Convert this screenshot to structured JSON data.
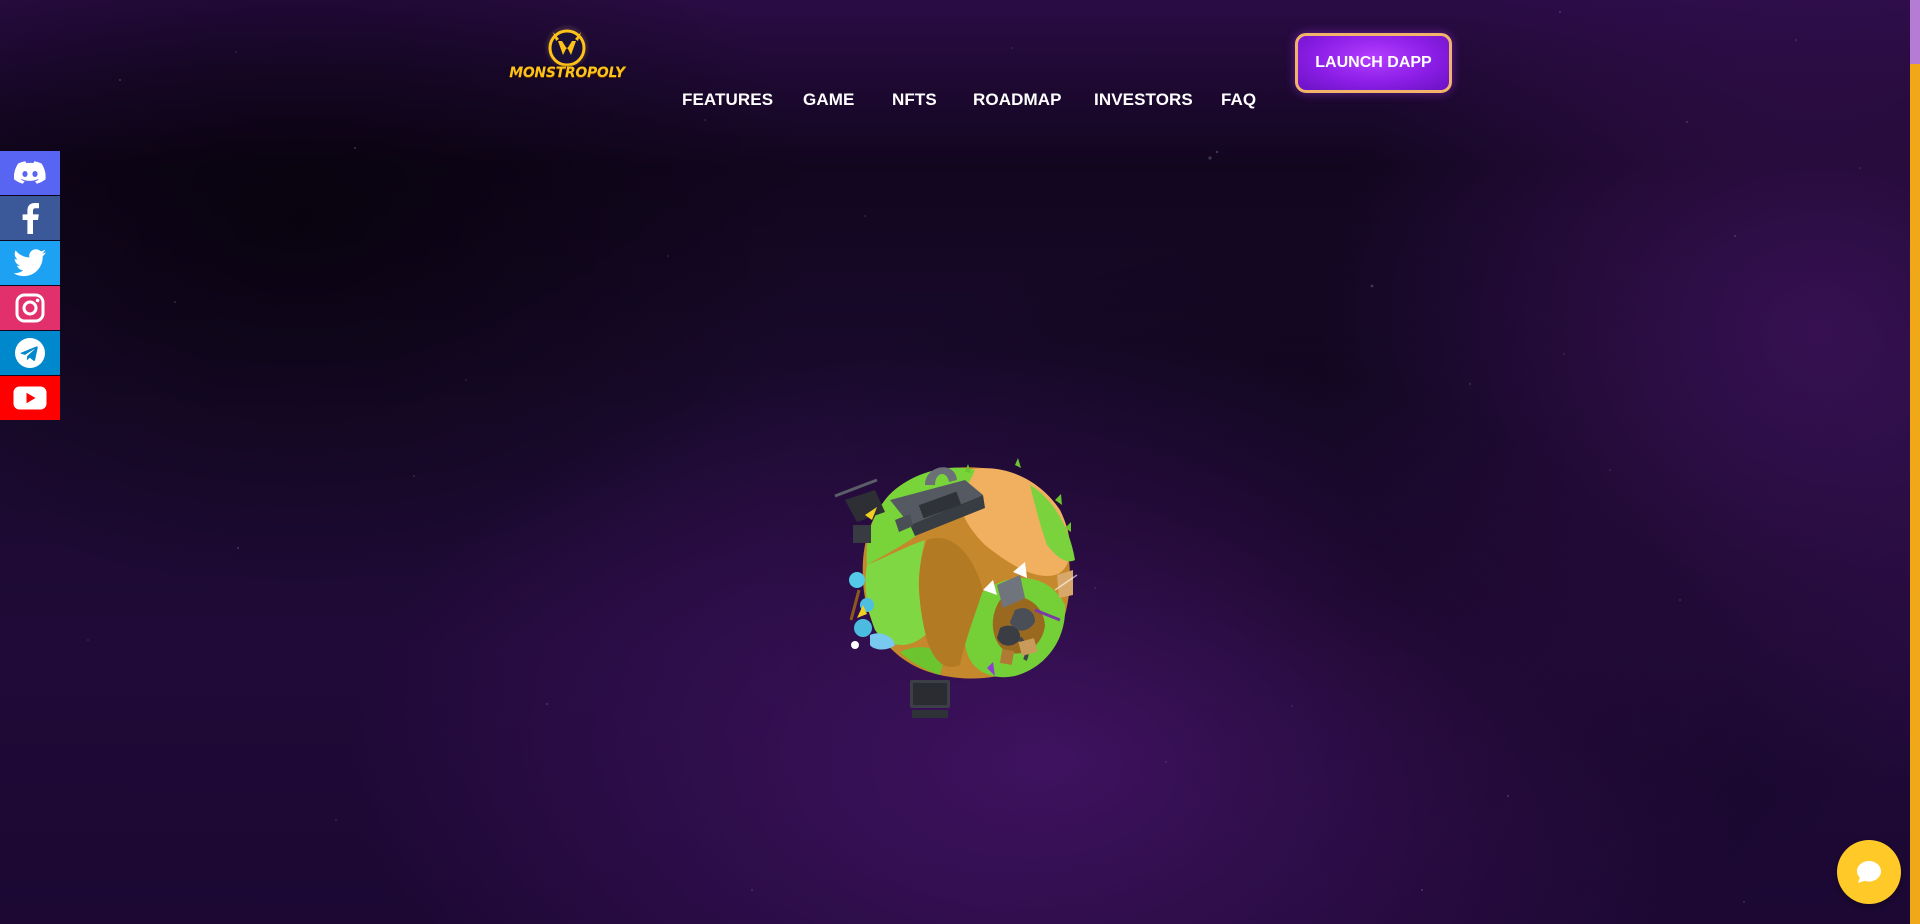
{
  "brand": {
    "name": "MONSTROPOLY",
    "accent_color": "#ffc21a"
  },
  "nav": {
    "items": [
      {
        "label": "FEATURES"
      },
      {
        "label": "GAME"
      },
      {
        "label": "NFTS"
      },
      {
        "label": "ROADMAP"
      },
      {
        "label": "INVESTORS"
      },
      {
        "label": "FAQ"
      }
    ],
    "cta_label": "LAUNCH DAPP",
    "cta_color": "#8c1ee6"
  },
  "social": [
    {
      "icon": "discord-icon",
      "color": "#5865f2"
    },
    {
      "icon": "facebook-icon",
      "color": "#3b5998"
    },
    {
      "icon": "twitter-icon",
      "color": "#1da1f2"
    },
    {
      "icon": "instagram-icon",
      "color": "#e1306c"
    },
    {
      "icon": "telegram-icon",
      "color": "#0088cc"
    },
    {
      "icon": "youtube-icon",
      "color": "#ff0000"
    }
  ],
  "chat": {
    "icon": "chat-bubble-icon",
    "color": "#ffc928"
  }
}
